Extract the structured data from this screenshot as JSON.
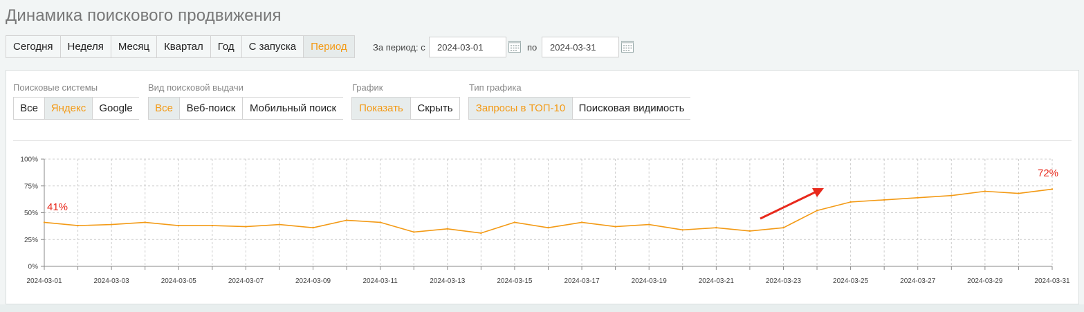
{
  "page": {
    "title": "Динамика поискового продвижения"
  },
  "period_tabs": [
    {
      "label": "Сегодня",
      "active": false
    },
    {
      "label": "Неделя",
      "active": false
    },
    {
      "label": "Месяц",
      "active": false
    },
    {
      "label": "Квартал",
      "active": false
    },
    {
      "label": "Год",
      "active": false
    },
    {
      "label": "С запуска",
      "active": false
    },
    {
      "label": "Период",
      "active": true
    }
  ],
  "range": {
    "label_from": "За период: с",
    "from": "2024-03-01",
    "label_to": "по",
    "to": "2024-03-31"
  },
  "filters": {
    "engines": {
      "label": "Поисковые системы",
      "options": [
        "Все",
        "Яндекс",
        "Google"
      ],
      "active_index": 1
    },
    "serp": {
      "label": "Вид поисковой выдачи",
      "options": [
        "Все",
        "Веб-поиск",
        "Мобильный поиск"
      ],
      "active_index": 0
    },
    "chart": {
      "label": "График",
      "options": [
        "Показать",
        "Скрыть"
      ],
      "active_index": 0
    },
    "chart_type": {
      "label": "Тип графика",
      "options": [
        "Запросы в ТОП-10",
        "Поисковая видимость"
      ],
      "active_index": 0
    }
  },
  "colors": {
    "accent": "#f39a15",
    "line": "#f39a15",
    "annotation": "#e8291c",
    "grid": "#cccccc"
  },
  "chart_data": {
    "type": "line",
    "x": [
      "2024-03-01",
      "2024-03-02",
      "2024-03-03",
      "2024-03-04",
      "2024-03-05",
      "2024-03-06",
      "2024-03-07",
      "2024-03-08",
      "2024-03-09",
      "2024-03-10",
      "2024-03-11",
      "2024-03-12",
      "2024-03-13",
      "2024-03-14",
      "2024-03-15",
      "2024-03-16",
      "2024-03-17",
      "2024-03-18",
      "2024-03-19",
      "2024-03-20",
      "2024-03-21",
      "2024-03-22",
      "2024-03-23",
      "2024-03-24",
      "2024-03-25",
      "2024-03-26",
      "2024-03-27",
      "2024-03-28",
      "2024-03-29",
      "2024-03-30",
      "2024-03-31"
    ],
    "series": [
      {
        "values": [
          41,
          38,
          39,
          41,
          38,
          38,
          37,
          39,
          36,
          43,
          41,
          32,
          35,
          31,
          41,
          36,
          41,
          37,
          39,
          34,
          36,
          33,
          36,
          52,
          60,
          62,
          64,
          66,
          70,
          68,
          72
        ]
      }
    ],
    "x_tick_labels": [
      "2024-03-01",
      "2024-03-03",
      "2024-03-05",
      "2024-03-07",
      "2024-03-09",
      "2024-03-11",
      "2024-03-13",
      "2024-03-15",
      "2024-03-17",
      "2024-03-19",
      "2024-03-21",
      "2024-03-23",
      "2024-03-25",
      "2024-03-27",
      "2024-03-29",
      "2024-03-31"
    ],
    "y_tick_labels": [
      "0%",
      "25%",
      "50%",
      "75%",
      "100%"
    ],
    "ylim": [
      0,
      100
    ],
    "grid": true,
    "annotations": {
      "start_label": "41%",
      "end_label": "72%",
      "trend_arrow": "up-right"
    }
  }
}
